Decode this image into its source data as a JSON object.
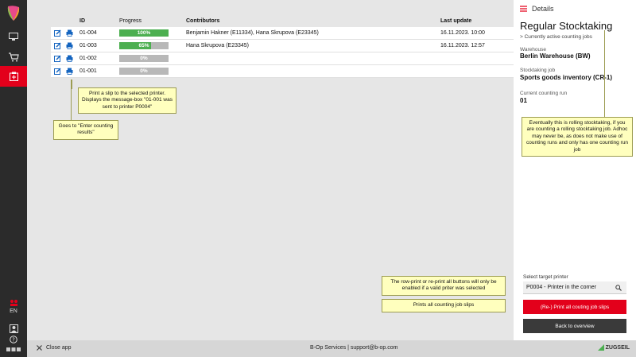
{
  "sidebar": {
    "language": "EN"
  },
  "table": {
    "headers": {
      "id": "ID",
      "progress": "Progress",
      "contributors": "Contributors",
      "last_update": "Last update"
    },
    "rows": [
      {
        "id": "01-004",
        "progress": 100,
        "progress_label": "100%",
        "contributors": "Benjamin Hakner (E11334), Hana Skrupova (E23345)",
        "last_update": "16.11.2023. 10:00"
      },
      {
        "id": "01-003",
        "progress": 65,
        "progress_label": "65%",
        "contributors": "Hana Skrupova (E23345)",
        "last_update": "16.11.2023. 12:57"
      },
      {
        "id": "01-002",
        "progress": 0,
        "progress_label": "0%",
        "contributors": "",
        "last_update": ""
      },
      {
        "id": "01-001",
        "progress": 0,
        "progress_label": "0%",
        "contributors": "",
        "last_update": ""
      }
    ]
  },
  "tooltips": {
    "print_slip": "Print a slip to the selected printer. Displays the message-box \"01-001 was sent to printer P0004\"",
    "enter_results": "Goes to \"Enter counting results\"",
    "rolling": "Eventually this is rolling stocktaking, if you are counting a rolling stocktaking job. Adhoc may never be, as does not make use of counting runs and only has one counting run job",
    "printer_enable": "The row-print or re-print all buttons will only be enabled if a valid priter was selected",
    "print_all": "Prints all counting job slips"
  },
  "panel": {
    "header": "Details",
    "title": "Regular Stocktaking",
    "subtitle": "> Currently active counting jobs",
    "warehouse_label": "Warehouse",
    "warehouse_value": "Berlin Warehouse (BW)",
    "job_label": "Stocktaking job",
    "job_value": "Sports goods inventory (CR-1)",
    "run_label": "Current counting run",
    "run_value": "01",
    "printer_label": "Select target printer",
    "printer_value": "P0004 - Printer in the corner",
    "print_all_button": "(Re-) Print all couting job slips",
    "back_button": "Back to overview"
  },
  "footer": {
    "close": "Close app",
    "center": "B-Op Services | support@b-op.com",
    "brand": "ZUGSEIL"
  },
  "colors": {
    "accent": "#e3001b",
    "progress": "#4caf50",
    "tooltip": "#ffffbe"
  }
}
